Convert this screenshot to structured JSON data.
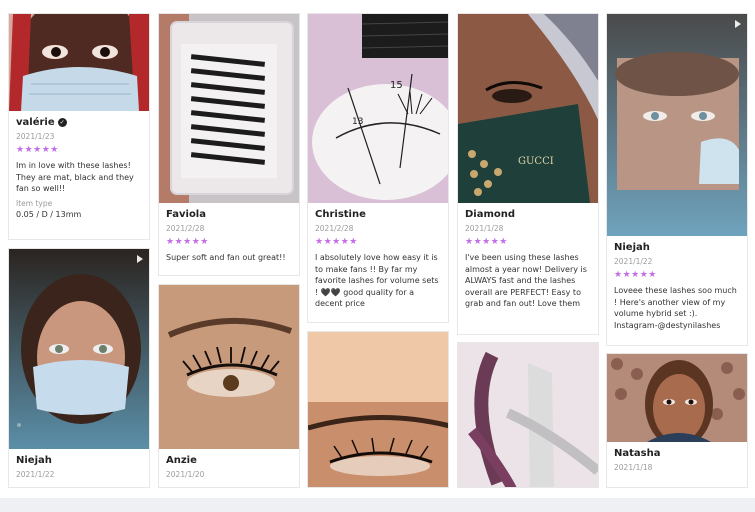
{
  "stars_text": "★★★★★",
  "colors": {
    "star": "#c36ee6",
    "page_bg": "#eef0f3",
    "card_border": "#e7e7e7"
  },
  "reviews": [
    {
      "name": "valérie",
      "verified": true,
      "date": "2021/1/23",
      "rating": 5,
      "text": "Im in love with these lashes! They are mat, black and they fan so well!!",
      "item_type_label": "Item type",
      "item_type": "0.05 / D / 13mm"
    },
    {
      "name": "Faviola",
      "date": "2021/2/28",
      "rating": 5,
      "text": "Super soft and fan out great!!"
    },
    {
      "name": "Christine",
      "date": "2021/2/28",
      "rating": 5,
      "text": "I absolutely love how easy it is to make fans !! By far my favorite lashes for volume sets ! 🖤🖤 good quality for a decent price"
    },
    {
      "name": "Diamond",
      "date": "2021/1/28",
      "rating": 5,
      "text": "I've been using these lashes almost a year now! Delivery is ALWAYS fast and the lashes overall are PERFECT! Easy to grab and fan out! Love them"
    },
    {
      "name": "Niejah",
      "date": "2021/1/22",
      "rating": 5,
      "text": "Loveee these lashes soo much ! Here's another view of my volume hybrid set :). Instagram-@destynilashes"
    },
    {
      "name": "Niejah",
      "date": "2021/1/22"
    },
    {
      "name": "Anzie",
      "date": "2021/1/20"
    },
    {
      "name": "Natasha",
      "date": "2021/1/18"
    }
  ]
}
